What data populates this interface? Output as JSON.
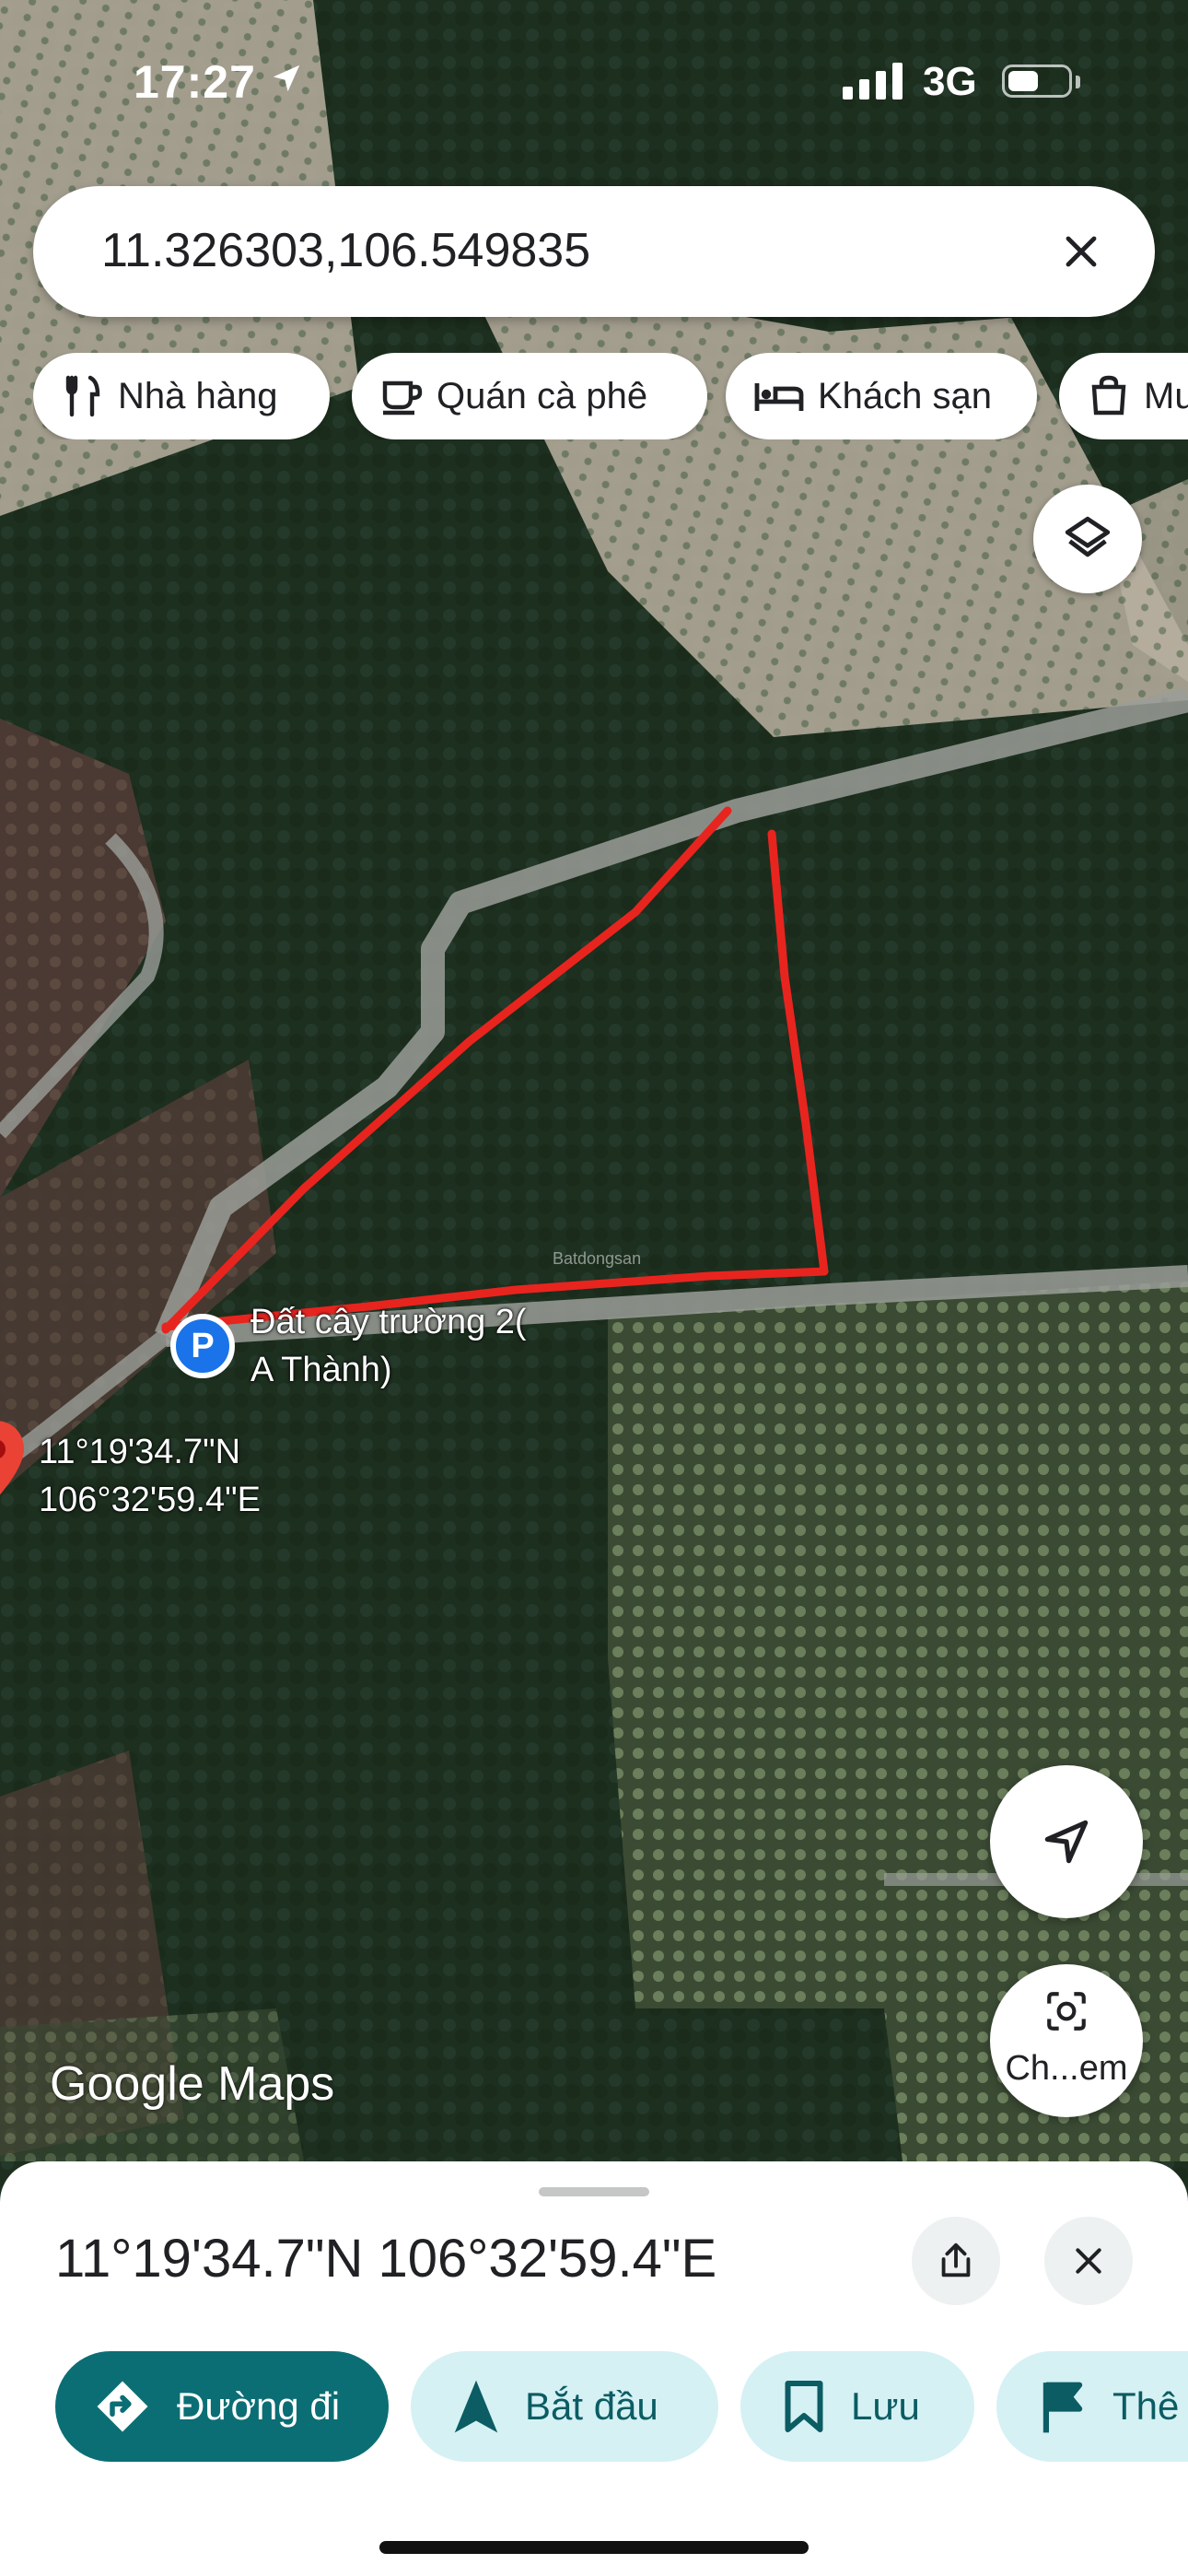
{
  "status_bar": {
    "time": "17:27",
    "network": "3G"
  },
  "search": {
    "query": "11.326303,106.549835"
  },
  "chips": [
    {
      "label": "Nhà hàng",
      "icon": "fork-knife-icon"
    },
    {
      "label": "Quán cà phê",
      "icon": "coffee-cup-icon"
    },
    {
      "label": "Khách sạn",
      "icon": "bed-icon"
    },
    {
      "label": "Mu",
      "icon": "shopping-bag-icon"
    }
  ],
  "map": {
    "place_label": "Đất cây trường 2( A Thành)",
    "pin_coords": [
      "11°19'34.7\"N",
      "106°32'59.4\"E"
    ],
    "attribution": "Google Maps",
    "watermark": "Batdongsan",
    "colors": {
      "boundary": "#e8241f",
      "road": "#9a9d98",
      "pin": "#ea4335",
      "parking": "#1a73e8"
    }
  },
  "fabs": {
    "lens_label": "Ch...em"
  },
  "sheet": {
    "coords": "11°19'34.7\"N 106°32'59.4\"E",
    "actions": [
      {
        "label": "Đường đi",
        "icon": "directions-icon"
      },
      {
        "label": "Bắt đầu",
        "icon": "navigation-arrow-icon"
      },
      {
        "label": "Lưu",
        "icon": "bookmark-icon"
      },
      {
        "label": "Thê",
        "icon": "flag-icon"
      }
    ]
  }
}
